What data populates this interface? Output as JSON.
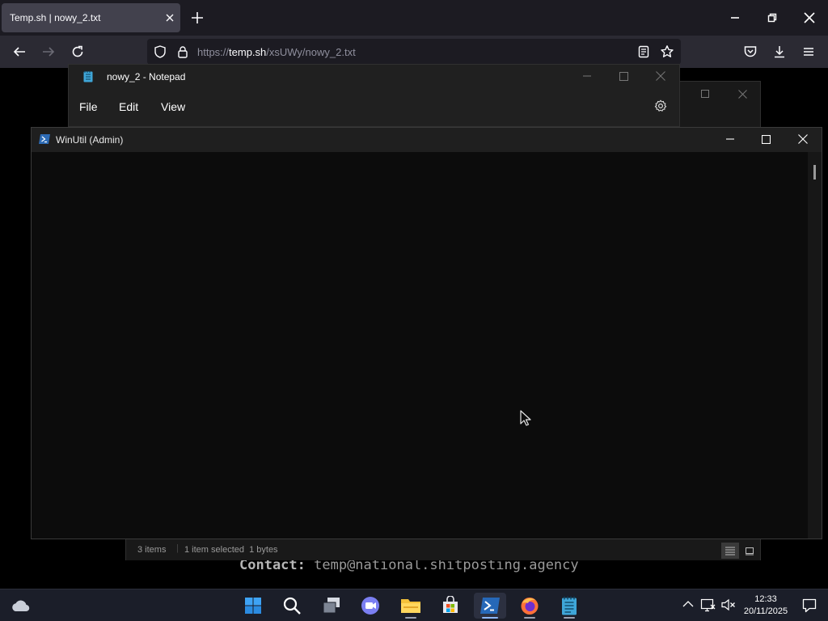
{
  "browser": {
    "tab_title": "Temp.sh | nowy_2.txt",
    "url_prefix": "https://",
    "url_domain": "temp.sh",
    "url_path": "/xsUWy/nowy_2.txt"
  },
  "page": {
    "contact_label": "Contact:",
    "contact_value": " temp@national.shitposting.agency"
  },
  "explorer": {
    "status_items": "3 items",
    "status_selection": "1 item selected  1 bytes"
  },
  "notepad": {
    "title": "nowy_2 - Notepad",
    "menu": [
      "File",
      "Edit",
      "View"
    ]
  },
  "winutil": {
    "title": "WinUtil (Admin)"
  },
  "taskbar": {
    "time": "12:33",
    "date": "20/11/2025",
    "apps": [
      "start-icon",
      "search-icon",
      "task-view-icon",
      "chat-icon",
      "file-explorer-icon",
      "store-icon",
      "powershell-icon",
      "firefox-icon",
      "notepad-icon"
    ],
    "active_app": "powershell-icon"
  }
}
